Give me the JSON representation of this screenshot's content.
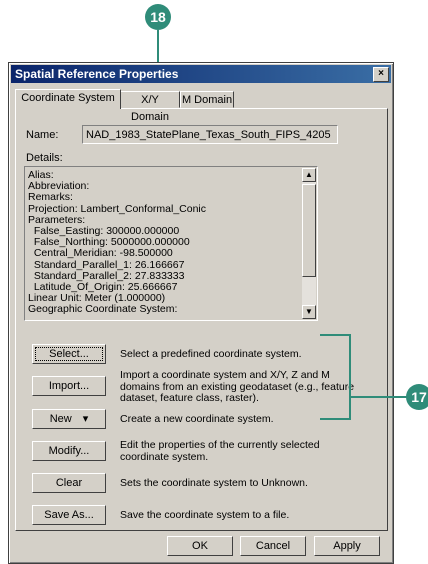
{
  "callouts": {
    "top": "18",
    "right": "17"
  },
  "window": {
    "title": "Spatial Reference Properties",
    "close_glyph": "×",
    "tabs": [
      "Coordinate System",
      "X/Y Domain",
      "M Domain"
    ],
    "name_label": "Name:",
    "name_value": "NAD_1983_StatePlane_Texas_South_FIPS_4205",
    "details_label": "Details:",
    "details_lines": [
      "Alias:",
      "Abbreviation:",
      "Remarks:",
      "Projection: Lambert_Conformal_Conic",
      "Parameters:",
      "  False_Easting: 300000.000000",
      "  False_Northing: 5000000.000000",
      "  Central_Meridian: -98.500000",
      "  Standard_Parallel_1: 26.166667",
      "  Standard_Parallel_2: 27.833333",
      "  Latitude_Of_Origin: 25.666667",
      "Linear Unit: Meter (1.000000)",
      "Geographic Coordinate System:"
    ],
    "actions": [
      {
        "label": "Select...",
        "desc": "Select a predefined coordinate system."
      },
      {
        "label": "Import...",
        "desc": "Import a coordinate system and X/Y, Z and M domains from an existing geodataset (e.g., feature dataset, feature class, raster)."
      },
      {
        "label": "New",
        "arrow": "▾",
        "desc": "Create a new coordinate system."
      },
      {
        "label": "Modify...",
        "desc": "Edit the properties of the currently selected coordinate system."
      },
      {
        "label": "Clear",
        "desc": "Sets the coordinate system to Unknown."
      },
      {
        "label": "Save As...",
        "desc": "Save the coordinate system to a file."
      }
    ],
    "footer": {
      "ok": "OK",
      "cancel": "Cancel",
      "apply": "Apply"
    }
  },
  "colors": {
    "callout": "#2f8c79",
    "titlebar": "#0a246a",
    "face": "#d4d0c8"
  }
}
